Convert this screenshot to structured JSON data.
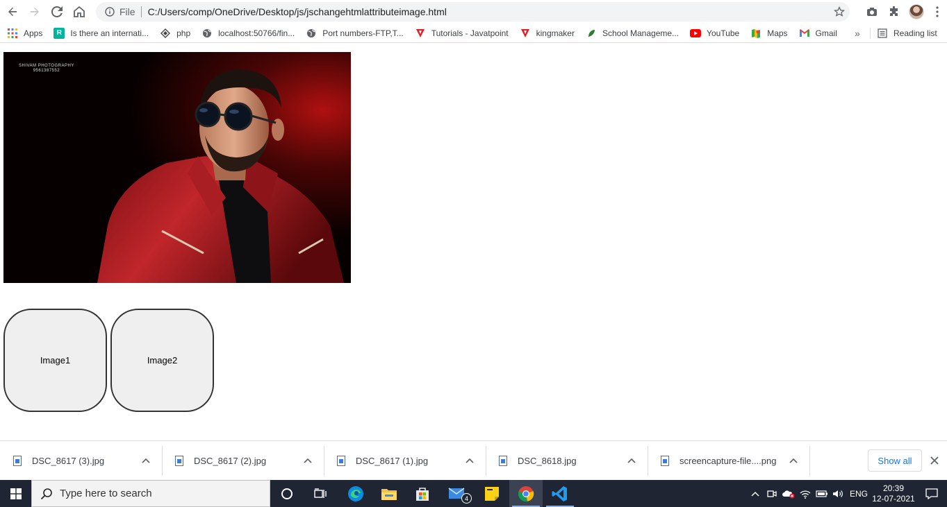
{
  "browser": {
    "omnibox": {
      "scheme_label": "File",
      "url": "C:/Users/comp/OneDrive/Desktop/js/jschangehtmlattributeimage.html"
    },
    "bookmarks": [
      {
        "label": "Apps",
        "icon": "apps-grid-icon"
      },
      {
        "label": "Is there an internati...",
        "icon": "r-logo-icon"
      },
      {
        "label": "php",
        "icon": "diamond-icon"
      },
      {
        "label": "localhost:50766/fin...",
        "icon": "globe-icon"
      },
      {
        "label": "Port numbers-FTP,T...",
        "icon": "globe-icon"
      },
      {
        "label": "Tutorials - Javatpoint",
        "icon": "javatpoint-icon"
      },
      {
        "label": "kingmaker",
        "icon": "javatpoint-icon"
      },
      {
        "label": "School Manageme...",
        "icon": "leaf-icon"
      },
      {
        "label": "YouTube",
        "icon": "youtube-icon"
      },
      {
        "label": "Maps",
        "icon": "maps-icon"
      },
      {
        "label": "Gmail",
        "icon": "gmail-icon"
      }
    ],
    "reading_list": "Reading list"
  },
  "page": {
    "photo_watermark_line1": "SHIVAM PHOTOGRAPHY",
    "photo_watermark_line2": "9561387552",
    "buttons": [
      {
        "label": "Image1"
      },
      {
        "label": "Image2"
      }
    ]
  },
  "downloads": {
    "items": [
      {
        "name": "DSC_8617 (3).jpg"
      },
      {
        "name": "DSC_8617 (2).jpg"
      },
      {
        "name": "DSC_8617 (1).jpg"
      },
      {
        "name": "DSC_8618.jpg"
      },
      {
        "name": "screencapture-file....png"
      }
    ],
    "show_all": "Show all"
  },
  "taskbar": {
    "search_placeholder": "Type here to search",
    "mail_badge": "4",
    "language": "ENG",
    "time": "20:39",
    "date": "12-07-2021"
  },
  "colors": {
    "accent_blue": "#1a73e8",
    "taskbar_bg": "#1f2533",
    "jacket_red": "#9b1a1e"
  }
}
